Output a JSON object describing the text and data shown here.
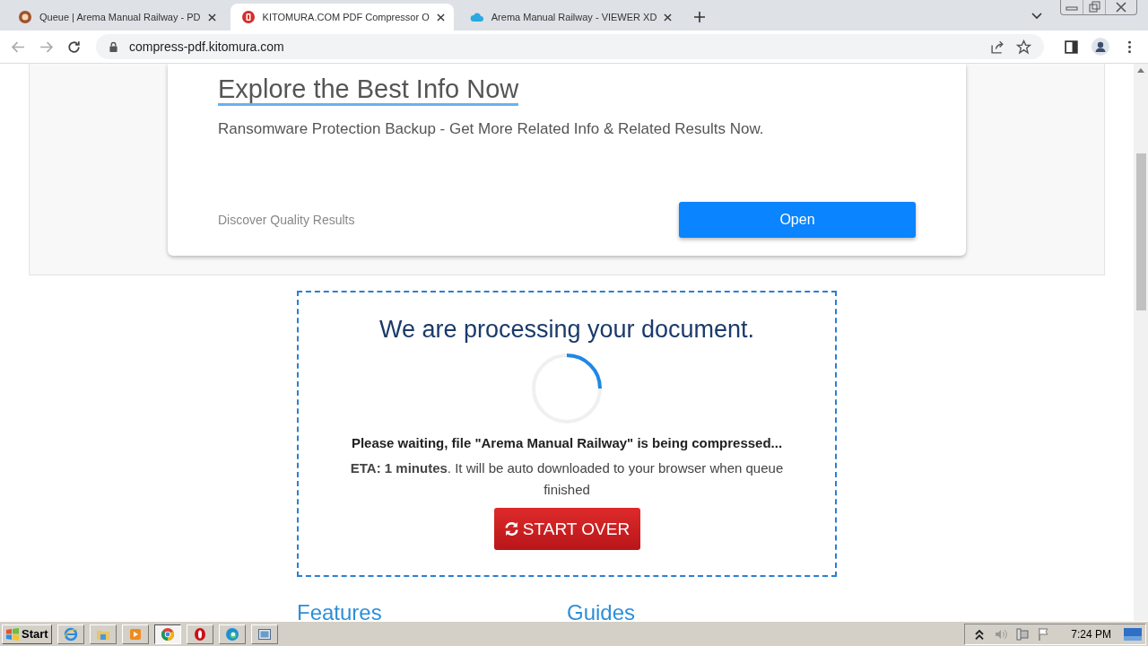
{
  "browser": {
    "tabs": [
      {
        "title": "Queue | Arema Manual Railway - PD",
        "selected": false
      },
      {
        "title": "KITOMURA.COM PDF Compressor O",
        "selected": true
      },
      {
        "title": "Arema Manual Railway - VIEWER XD",
        "selected": false
      }
    ],
    "address": "compress-pdf.kitomura.com"
  },
  "ad": {
    "title": "Explore the Best Info Now",
    "description": "Ransomware Protection Backup - Get More Related Info & Related Results Now.",
    "footer": "Discover Quality Results",
    "button": "Open"
  },
  "processing": {
    "title": "We are processing your document.",
    "message": "Please waiting, file \"Arema Manual Railway\" is being compressed...",
    "eta": "**ETA: 1 minutes**. It will be auto downloaded to your browser when queue finished",
    "button": "START OVER"
  },
  "sections": [
    "Features",
    "Guides"
  ],
  "taskbar": {
    "start": "Start",
    "apps": [
      {
        "kind": "ie",
        "selected": false
      },
      {
        "kind": "folder",
        "selected": false
      },
      {
        "kind": "media",
        "selected": false
      },
      {
        "kind": "chrome",
        "selected": true
      },
      {
        "kind": "opera",
        "selected": false
      },
      {
        "kind": "edge",
        "selected": false
      },
      {
        "kind": "screen",
        "selected": false
      }
    ],
    "clock": "7:24 PM"
  }
}
